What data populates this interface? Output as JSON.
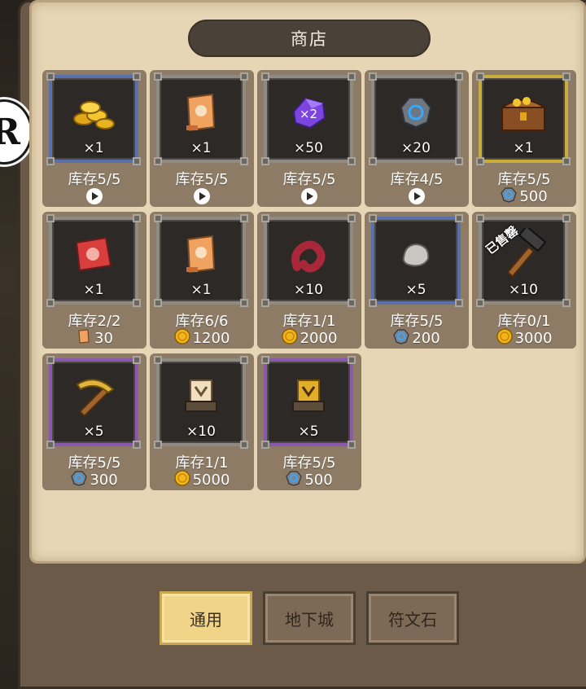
{
  "left_badge": "R",
  "shop": {
    "title": "商店"
  },
  "items": [
    {
      "name": "gold-coins-pack",
      "frame": "blue",
      "quantity": "×1",
      "stock": "库存5/5",
      "price_type": "ad",
      "price": ""
    },
    {
      "name": "scroll",
      "frame": "gray",
      "quantity": "×1",
      "stock": "库存5/5",
      "price_type": "ad",
      "price": ""
    },
    {
      "name": "purple-crystal-x2",
      "frame": "gray",
      "quantity": "×50",
      "stock": "库存5/5",
      "price_type": "ad",
      "price": "",
      "icon_label": "×2"
    },
    {
      "name": "rune-stone",
      "frame": "gray",
      "quantity": "×20",
      "stock": "库存4/5",
      "price_type": "ad",
      "price": ""
    },
    {
      "name": "treasure-chest",
      "frame": "gold",
      "quantity": "×1",
      "stock": "库存5/5",
      "price_type": "rune",
      "price": "500"
    },
    {
      "name": "red-scroll",
      "frame": "gray",
      "quantity": "×1",
      "stock": "库存2/2",
      "price_type": "scroll",
      "price": "30"
    },
    {
      "name": "scroll",
      "frame": "gray",
      "quantity": "×1",
      "stock": "库存6/6",
      "price_type": "gold",
      "price": "1200"
    },
    {
      "name": "red-worm",
      "frame": "gray",
      "quantity": "×10",
      "stock": "库存1/1",
      "price_type": "gold",
      "price": "2000"
    },
    {
      "name": "stone",
      "frame": "blue",
      "quantity": "×5",
      "stock": "库存5/5",
      "price_type": "rune",
      "price": "200"
    },
    {
      "name": "hammer",
      "frame": "gray",
      "quantity": "×10",
      "stock": "库存0/1",
      "price_type": "gold",
      "price": "3000",
      "sold_label": "已售罄"
    },
    {
      "name": "pickaxe",
      "frame": "purple",
      "quantity": "×5",
      "stock": "库存5/5",
      "price_type": "rune",
      "price": "300"
    },
    {
      "name": "parchment-stand",
      "frame": "gray",
      "quantity": "×10",
      "stock": "库存1/1",
      "price_type": "gold",
      "price": "5000"
    },
    {
      "name": "gold-stand",
      "frame": "purple",
      "quantity": "×5",
      "stock": "库存5/5",
      "price_type": "rune",
      "price": "500"
    }
  ],
  "tabs": [
    {
      "label": "通用",
      "active": true
    },
    {
      "label": "地下城",
      "active": false
    },
    {
      "label": "符文石",
      "active": false
    }
  ],
  "colors": {
    "parchment": "#e6d6b5",
    "card": "#8d7b65",
    "slot_blue": "#5a70ad",
    "slot_gold": "#c8ad3d",
    "slot_purple": "#8a58ad",
    "tab_active": "#f0d488"
  }
}
